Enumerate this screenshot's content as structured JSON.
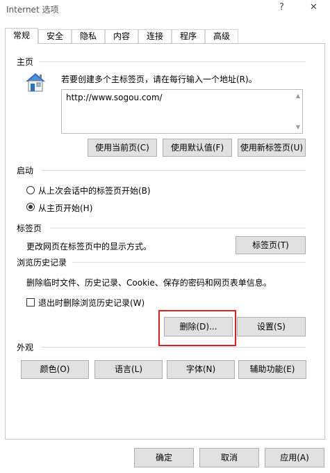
{
  "window": {
    "title": "Internet 选项",
    "help": "?",
    "close": "✕"
  },
  "tabs": [
    "常规",
    "安全",
    "隐私",
    "内容",
    "连接",
    "程序",
    "高级"
  ],
  "homepage": {
    "label": "主页",
    "instruction": "若要创建多个主标签页，请在每行输入一个地址(R)。",
    "value": "http://www.sogou.com/",
    "buttons": {
      "use_current": "使用当前页(C)",
      "use_default": "使用默认值(F)",
      "use_new_tab": "使用新标签页(U)"
    }
  },
  "startup": {
    "label": "启动",
    "options": [
      "从上次会话中的标签页开始(B)",
      "从主页开始(H)"
    ],
    "selected_index": 1
  },
  "tabs_section": {
    "label": "标签页",
    "description": "更改网页在标签页中的显示方式。",
    "button": "标签页(T)"
  },
  "history": {
    "label": "浏览历史记录",
    "description": "删除临时文件、历史记录、Cookie、保存的密码和网页表单信息。",
    "checkbox_label": "退出时删除浏览历史记录(W)",
    "checkbox_checked": false,
    "buttons": {
      "delete": "删除(D)...",
      "settings": "设置(S)"
    }
  },
  "appearance": {
    "label": "外观",
    "buttons": {
      "colors": "颜色(O)",
      "languages": "语言(L)",
      "fonts": "字体(N)",
      "accessibility": "辅助功能(E)"
    }
  },
  "footer": {
    "ok": "确定",
    "cancel": "取消",
    "apply": "应用(A)"
  },
  "icons": {
    "home": "home-icon"
  },
  "colors": {
    "highlight": "#e02020",
    "button_bg": "#e1e1e1"
  }
}
